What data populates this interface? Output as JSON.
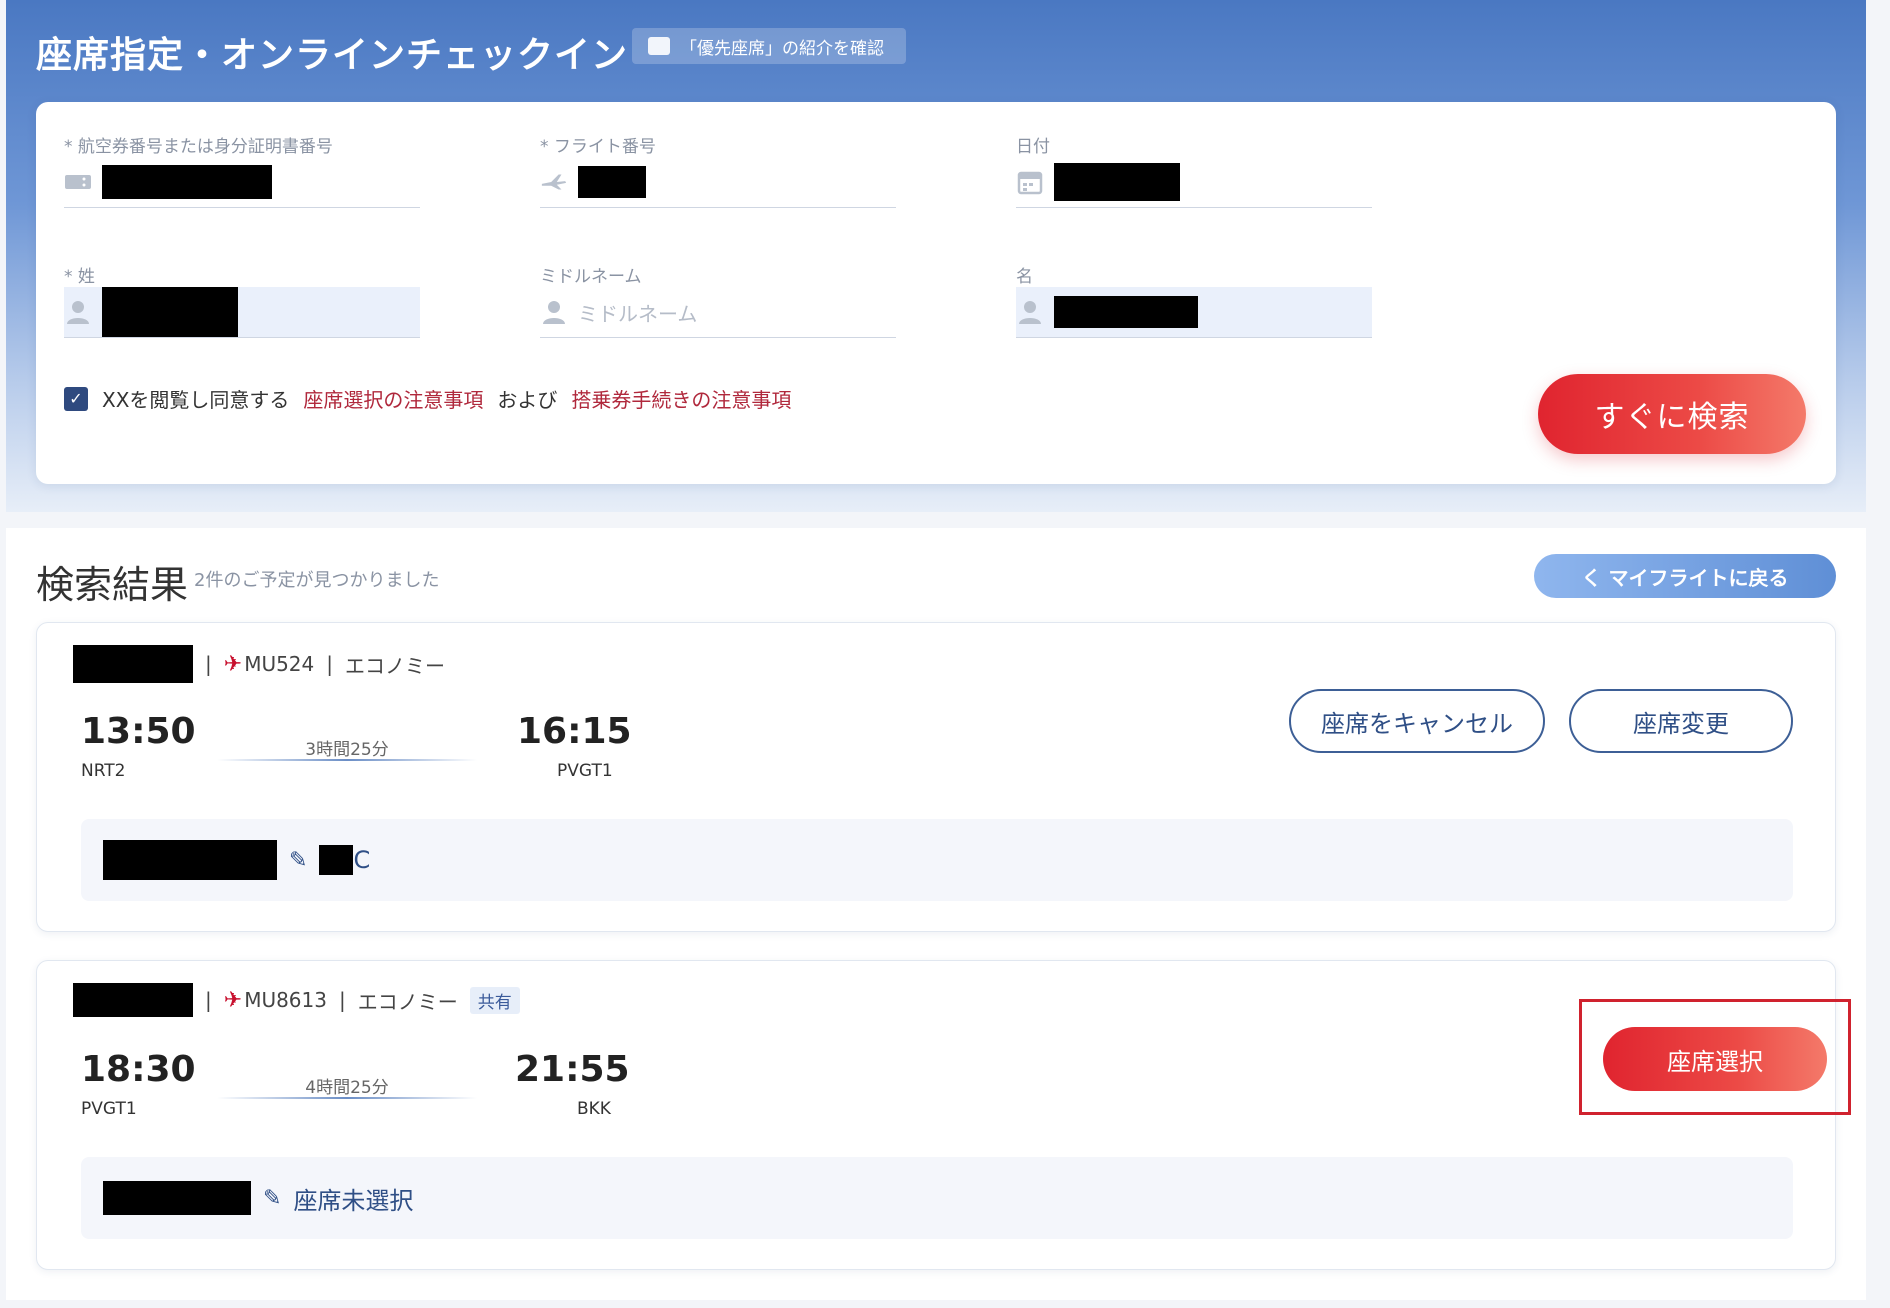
{
  "header": {
    "title": "座席指定・オンラインチェックイン",
    "priority_link": "「優先座席」の紹介を確認"
  },
  "form": {
    "ticket_label": "* 航空券番号または身分証明書番号",
    "flight_label": "* フライト番号",
    "date_label": "日付",
    "surname_label": "* 姓",
    "middle_label": "ミドルネーム",
    "middle_placeholder": "ミドルネーム",
    "given_label": "名",
    "agree_prefix": "XXを閲覧し同意する",
    "agree_link1": "座席選択の注意事項",
    "agree_mid": "および",
    "agree_link2": "搭乗券手続きの注意事項",
    "agree_checked": true,
    "search_button": "すぐに検索"
  },
  "results": {
    "title": "検索結果",
    "subtitle": "2件のご予定が見つかりました",
    "back_button": "く マイフライトに戻る",
    "flights": [
      {
        "flight_no": "MU524",
        "cabin": "エコノミー",
        "dep_time": "13:50",
        "dep_airport": "NRT2",
        "duration": "3時間25分",
        "arr_time": "16:15",
        "arr_airport": "PVGT1",
        "cancel_button": "座席をキャンセル",
        "change_button": "座席変更",
        "seat_suffix": "C"
      },
      {
        "flight_no": "MU8613",
        "cabin": "エコノミー",
        "shared": "共有",
        "dep_time": "18:30",
        "dep_airport": "PVGT1",
        "duration": "4時間25分",
        "arr_time": "21:55",
        "arr_airport": "BKK",
        "select_button": "座席選択",
        "seat_status": "座席未選択"
      }
    ]
  },
  "colors": {
    "accent_red": "#e0242f",
    "navy": "#2f4f86",
    "link_red": "#b0283c"
  },
  "icons": {
    "ticket": "ticket-icon",
    "plane": "plane-icon",
    "calendar": "calendar-icon",
    "person": "person-icon",
    "pencil": "pencil-icon",
    "check": "check-icon"
  }
}
